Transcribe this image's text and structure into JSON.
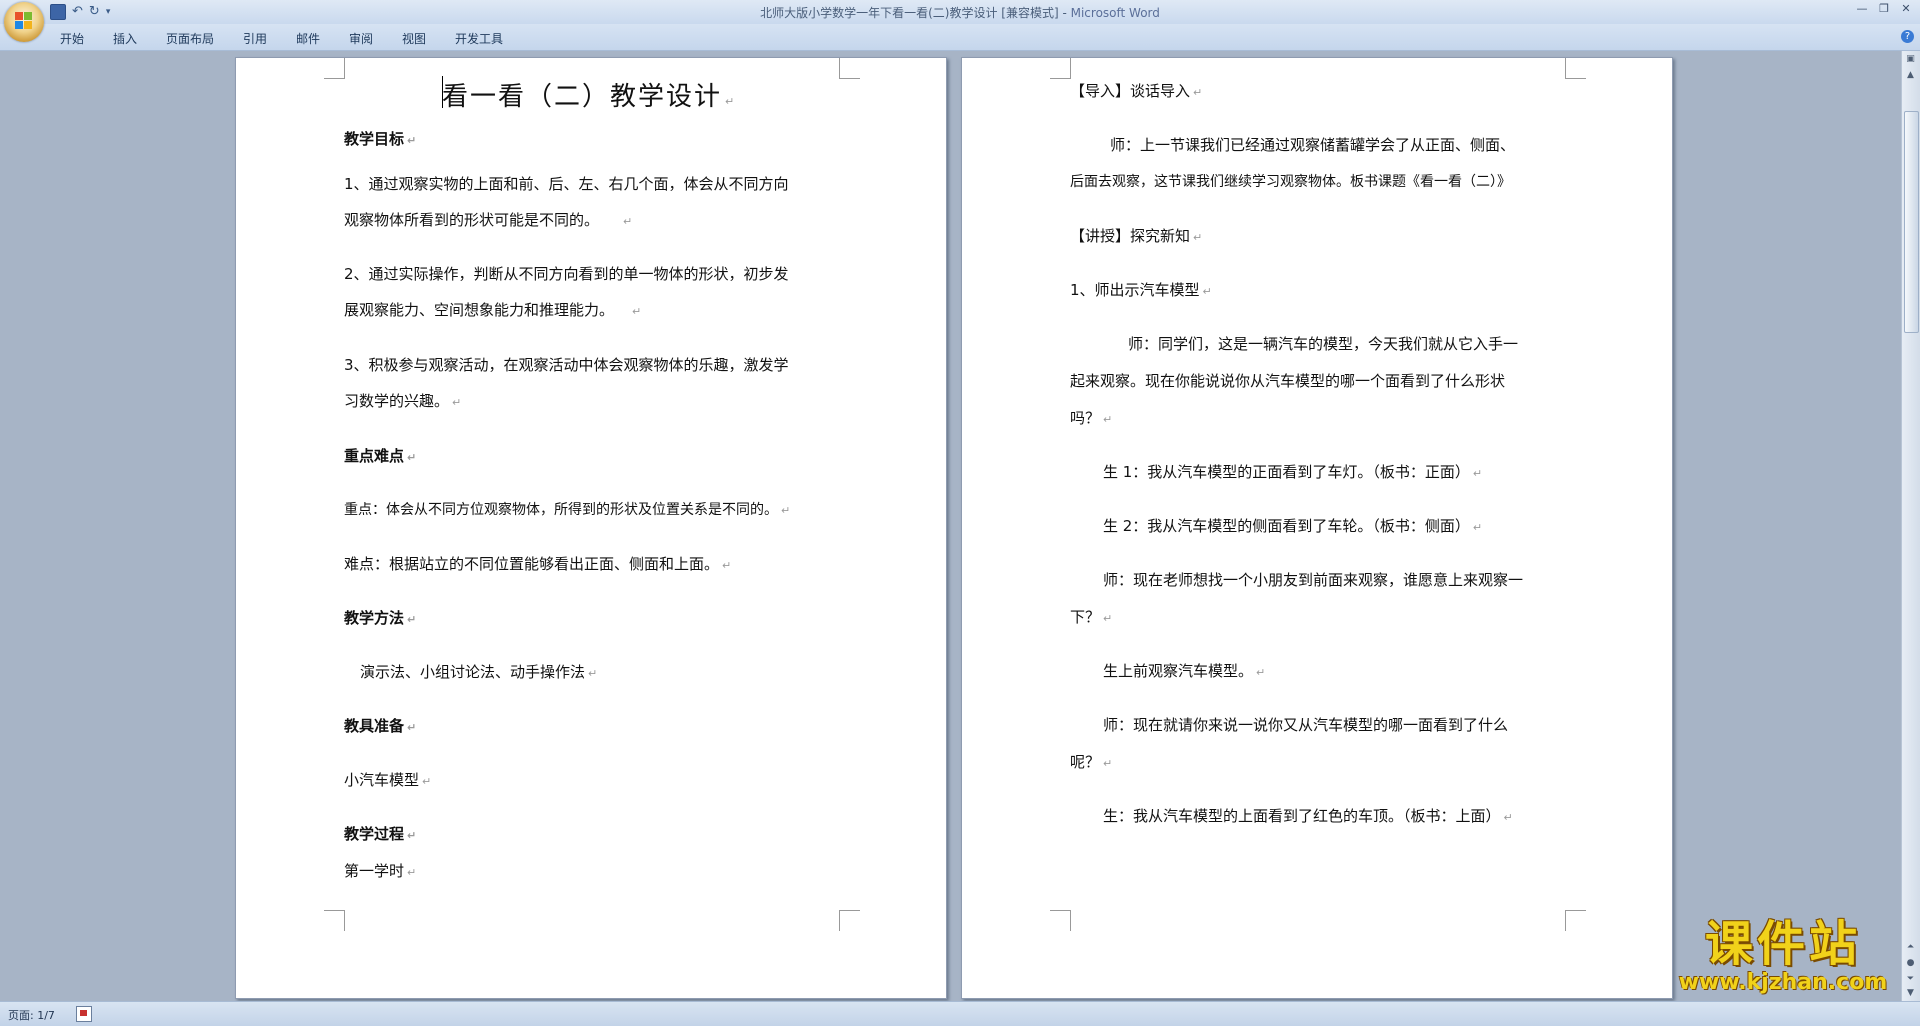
{
  "window": {
    "title": "北师大版小学数学一年下看一看(二)教学设计 [兼容模式] - ",
    "app_name": "Microsoft Word"
  },
  "ribbon": {
    "tabs": [
      "开始",
      "插入",
      "页面布局",
      "引用",
      "邮件",
      "审阅",
      "视图",
      "开发工具"
    ]
  },
  "left_page": {
    "title": "看一看（二）教学设计",
    "lines": [
      {
        "text": "教学目标",
        "bold": true
      },
      {
        "text": "1、通过观察实物的上面和前、后、左、右几个面，体会从不同方向",
        "bold": false
      },
      {
        "text": "观察物体所看到的形状可能是不同的。",
        "bold": false
      },
      {
        "text": "2、通过实际操作，判断从不同方向看到的单一物体的形状，初步发",
        "bold": false
      },
      {
        "text": "展观察能力、空间想象能力和推理能力。",
        "bold": false
      },
      {
        "text": "3、积极参与观察活动，在观察活动中体会观察物体的乐趣，激发学",
        "bold": false
      },
      {
        "text": "习数学的兴趣。",
        "bold": false
      },
      {
        "text": "重点难点",
        "bold": true
      },
      {
        "text": "重点：体会从不同方位观察物体，所得到的形状及位置关系是不同的。",
        "bold": false
      },
      {
        "text": "难点：根据站立的不同位置能够看出正面、侧面和上面。",
        "bold": false
      },
      {
        "text": "教学方法",
        "bold": true
      },
      {
        "text": "演示法、小组讨论法、动手操作法",
        "bold": false
      },
      {
        "text": "教具准备",
        "bold": true
      },
      {
        "text": "小汽车模型",
        "bold": false
      },
      {
        "text": "教学过程",
        "bold": true
      },
      {
        "text": "第一学时",
        "bold": false
      }
    ]
  },
  "right_page": {
    "lines": [
      {
        "text": "【导入】谈话导入"
      },
      {
        "text": "师：上一节课我们已经通过观察储蓄罐学会了从正面、侧面、"
      },
      {
        "text": "后面去观察，这节课我们继续学习观察物体。板书课题《看一看（二）》"
      },
      {
        "text": "【讲授】探究新知"
      },
      {
        "text": "1、师出示汽车模型"
      },
      {
        "text": "师：同学们，这是一辆汽车的模型，今天我们就从它入手一"
      },
      {
        "text": "起来观察。现在你能说说你从汽车模型的哪一个面看到了什么形状"
      },
      {
        "text": "吗？"
      },
      {
        "text": "生 1：我从汽车模型的正面看到了车灯。（板书：正面）"
      },
      {
        "text": "生 2：我从汽车模型的侧面看到了车轮。（板书：侧面）"
      },
      {
        "text": "师：现在老师想找一个小朋友到前面来观察，谁愿意上来观察一"
      },
      {
        "text": "下？"
      },
      {
        "text": "生上前观察汽车模型。"
      },
      {
        "text": "师：现在就请你来说一说你又从汽车模型的哪一面看到了什么"
      },
      {
        "text": "呢？"
      },
      {
        "text": "生：我从汽车模型的上面看到了红色的车顶。（板书：上面）"
      }
    ]
  },
  "status": {
    "page_info": "页面: 1/7"
  },
  "watermark": {
    "name": "课件站",
    "url": "www.kjzhan.com"
  },
  "colors": {
    "office_logo": [
      "#e8532b",
      "#7cbb2f",
      "#1e88e5",
      "#f2b31b"
    ],
    "paragraph_mark": "#9a9a9a"
  }
}
